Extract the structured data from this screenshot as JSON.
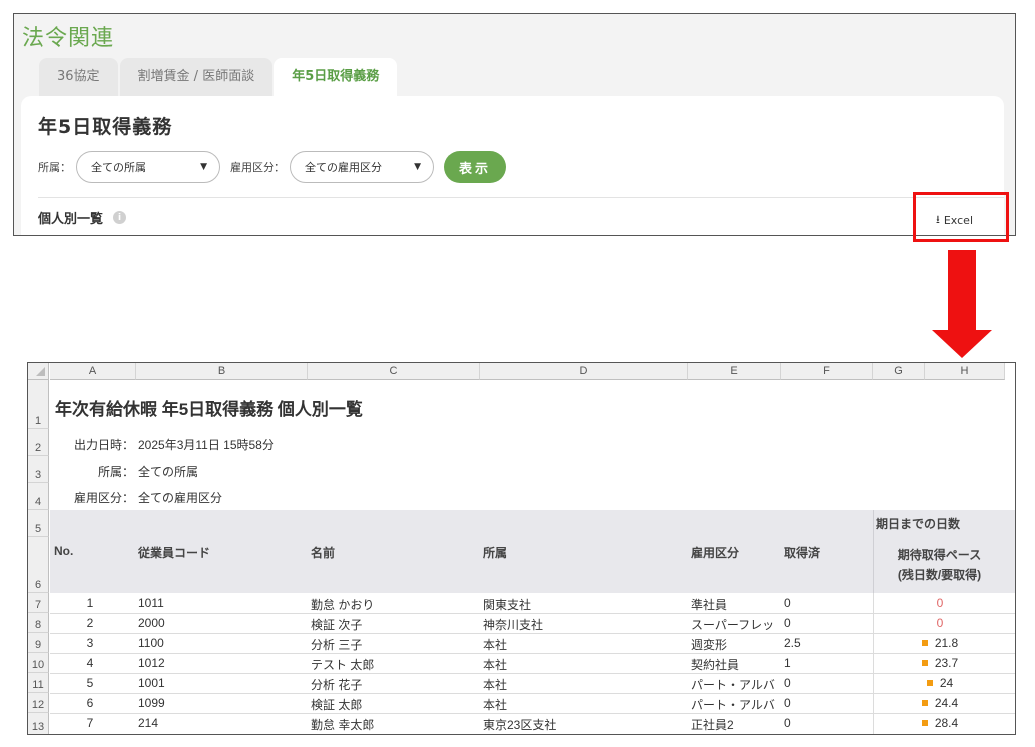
{
  "app": {
    "title": "法令関連",
    "tabs": [
      {
        "label": "36協定"
      },
      {
        "label": "割増賃金 / 医師面談"
      },
      {
        "label": "年5日取得義務"
      }
    ],
    "card": {
      "title": "年5日取得義務",
      "affiliation_label": "所属：",
      "affiliation_value": "全ての所属",
      "employment_label": "雇用区分：",
      "employment_value": "全ての雇用区分",
      "show_button": "表示",
      "section_title": "個人別一覧",
      "excel_label": "Excel"
    }
  },
  "colors": {
    "accent_green": "#6aa84f",
    "highlight_red": "#ee1111",
    "zero_red": "#e06666",
    "marker_orange": "#f39c12"
  },
  "sheet": {
    "columns": [
      "A",
      "B",
      "C",
      "D",
      "E",
      "F",
      "G",
      "H"
    ],
    "rows_numbers": [
      "1",
      "2",
      "3",
      "4",
      "5",
      "6",
      "7",
      "8",
      "9",
      "10",
      "11",
      "12",
      "13"
    ],
    "title": "年次有給休暇 年5日取得義務 個人別一覧",
    "meta": [
      {
        "label": "出力日時：",
        "value": "2025年3月11日 15時58分"
      },
      {
        "label": "所属：",
        "value": "全ての所属"
      },
      {
        "label": "雇用区分：",
        "value": "全ての雇用区分"
      }
    ],
    "header": {
      "no": "No.",
      "code": "従業員コード",
      "name": "名前",
      "affiliation": "所属",
      "employment": "雇用区分",
      "acquired": "取得済",
      "group": "期日までの日数",
      "expected_line1": "期待取得ペース",
      "expected_line2": "(残日数/要取得)"
    },
    "rows": [
      {
        "no": "1",
        "code": "1011",
        "name": "勤怠 かおり",
        "affiliation": "関東支社",
        "employment": "準社員",
        "acquired": "0",
        "pace": "0",
        "pace_style": "red"
      },
      {
        "no": "2",
        "code": "2000",
        "name": "検証 次子",
        "affiliation": "神奈川支社",
        "employment": "スーパーフレッ",
        "acquired": "0",
        "pace": "0",
        "pace_style": "red"
      },
      {
        "no": "3",
        "code": "1100",
        "name": "分析 三子",
        "affiliation": "本社",
        "employment": "週変形",
        "acquired": "2.5",
        "pace": "21.8",
        "pace_style": "orange"
      },
      {
        "no": "4",
        "code": "1012",
        "name": "テスト 太郎",
        "affiliation": "本社",
        "employment": "契約社員",
        "acquired": "1",
        "pace": "23.7",
        "pace_style": "orange"
      },
      {
        "no": "5",
        "code": "1001",
        "name": "分析 花子",
        "affiliation": "本社",
        "employment": "パート・アルバ",
        "acquired": "0",
        "pace": "24",
        "pace_style": "orange"
      },
      {
        "no": "6",
        "code": "1099",
        "name": "検証 太郎",
        "affiliation": "本社",
        "employment": "パート・アルバ",
        "acquired": "0",
        "pace": "24.4",
        "pace_style": "orange"
      },
      {
        "no": "7",
        "code": "214",
        "name": "勤怠 幸太郎",
        "affiliation": "東京23区支社",
        "employment": "正社員2",
        "acquired": "0",
        "pace": "28.4",
        "pace_style": "orange"
      }
    ]
  }
}
